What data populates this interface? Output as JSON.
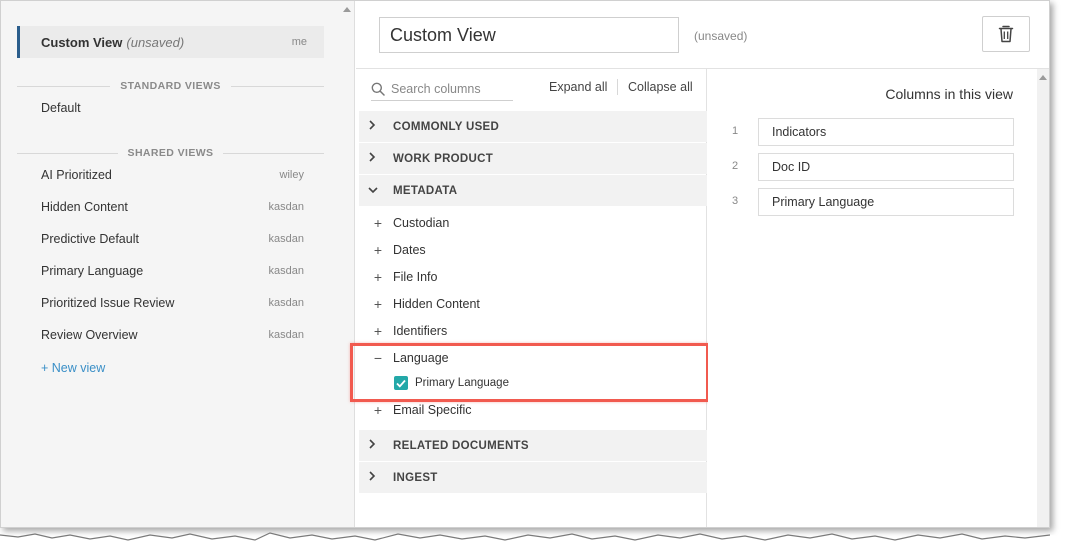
{
  "views_panel": {
    "current": {
      "name": "Custom View",
      "status": "(unsaved)",
      "owner": "me"
    },
    "standard_heading": "STANDARD VIEWS",
    "standard": [
      {
        "name": "Default"
      }
    ],
    "shared_heading": "SHARED VIEWS",
    "shared": [
      {
        "name": "AI Prioritized",
        "owner": "wiley"
      },
      {
        "name": "Hidden Content",
        "owner": "kasdan"
      },
      {
        "name": "Predictive Default",
        "owner": "kasdan"
      },
      {
        "name": "Primary Language",
        "owner": "kasdan"
      },
      {
        "name": "Prioritized Issue Review",
        "owner": "kasdan"
      },
      {
        "name": "Review Overview",
        "owner": "kasdan"
      }
    ],
    "new_view": "+ New view"
  },
  "header": {
    "view_name_value": "Custom View",
    "status": "(unsaved)",
    "delete_icon": "trash-icon"
  },
  "picker": {
    "search_placeholder": "Search columns",
    "expand_all": "Expand all",
    "collapse_all": "Collapse all",
    "groups": [
      {
        "label": "COMMONLY USED",
        "expanded": false
      },
      {
        "label": "WORK PRODUCT",
        "expanded": false
      },
      {
        "label": "METADATA",
        "expanded": true
      },
      {
        "label": "RELATED DOCUMENTS",
        "expanded": false
      },
      {
        "label": "INGEST",
        "expanded": false
      }
    ],
    "metadata_items": [
      {
        "label": "Custodian",
        "symbol": "+"
      },
      {
        "label": "Dates",
        "symbol": "+"
      },
      {
        "label": "File Info",
        "symbol": "+"
      },
      {
        "label": "Hidden Content",
        "symbol": "+"
      },
      {
        "label": "Identifiers",
        "symbol": "+"
      },
      {
        "label": "Language",
        "symbol": "−"
      },
      {
        "label": "Email Specific",
        "symbol": "+"
      }
    ],
    "language_checked_item": {
      "label": "Primary Language",
      "checked": true
    },
    "accent_color": "#23a8a8",
    "highlight_color": "#f15a4f"
  },
  "columns_panel": {
    "title": "Columns in this view",
    "columns": [
      {
        "num": "1",
        "label": "Indicators"
      },
      {
        "num": "2",
        "label": "Doc ID"
      },
      {
        "num": "3",
        "label": "Primary Language"
      }
    ]
  }
}
